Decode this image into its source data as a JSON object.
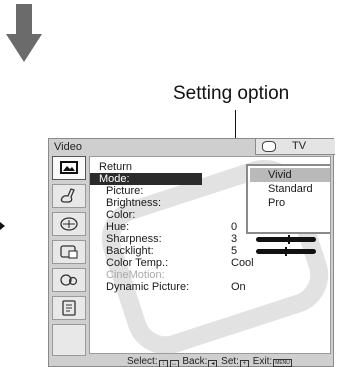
{
  "callout": {
    "label": "Setting option"
  },
  "window": {
    "title": "Video",
    "tab_label": "TV"
  },
  "side_icons": [
    {
      "name": "picture-icon",
      "active": true
    },
    {
      "name": "sound-icon",
      "active": false
    },
    {
      "name": "screen-icon",
      "active": false
    },
    {
      "name": "channel-setup-icon",
      "active": false
    },
    {
      "name": "parental-lock-icon",
      "active": false
    },
    {
      "name": "setup-icon",
      "active": false
    }
  ],
  "menu": {
    "return_label": "Return",
    "mode_label": "Mode:",
    "items": [
      {
        "label": "Picture:",
        "value": "",
        "bar": false,
        "dim": false
      },
      {
        "label": "Brightness:",
        "value": "",
        "bar": false,
        "dim": false
      },
      {
        "label": "Color:",
        "value": "",
        "bar": false,
        "dim": false
      },
      {
        "label": "Hue:",
        "value": "0",
        "bar": true,
        "dim": false
      },
      {
        "label": "Sharpness:",
        "value": "3",
        "bar": true,
        "dim": false
      },
      {
        "label": "Backlight:",
        "value": "5",
        "bar": true,
        "dim": false
      },
      {
        "label": "Color Temp.:",
        "value": "Cool",
        "bar": false,
        "dim": false
      },
      {
        "label": "CineMotion:",
        "value": "",
        "bar": false,
        "dim": true
      },
      {
        "label": "Dynamic Picture:",
        "value": "On",
        "bar": false,
        "dim": false
      }
    ]
  },
  "dropdown": {
    "options": [
      "Vivid",
      "Standard",
      "Pro"
    ],
    "selected": "Vivid"
  },
  "status": {
    "select_label": "Select:",
    "back_label": "Back:",
    "set_label": "Set:",
    "exit_label": "Exit:",
    "menu_key_label": "MENU"
  },
  "colors": {
    "highlight": "#2b2b2b",
    "selected_option": "#b9b9b9",
    "window_bg": "#cfcfcf"
  }
}
